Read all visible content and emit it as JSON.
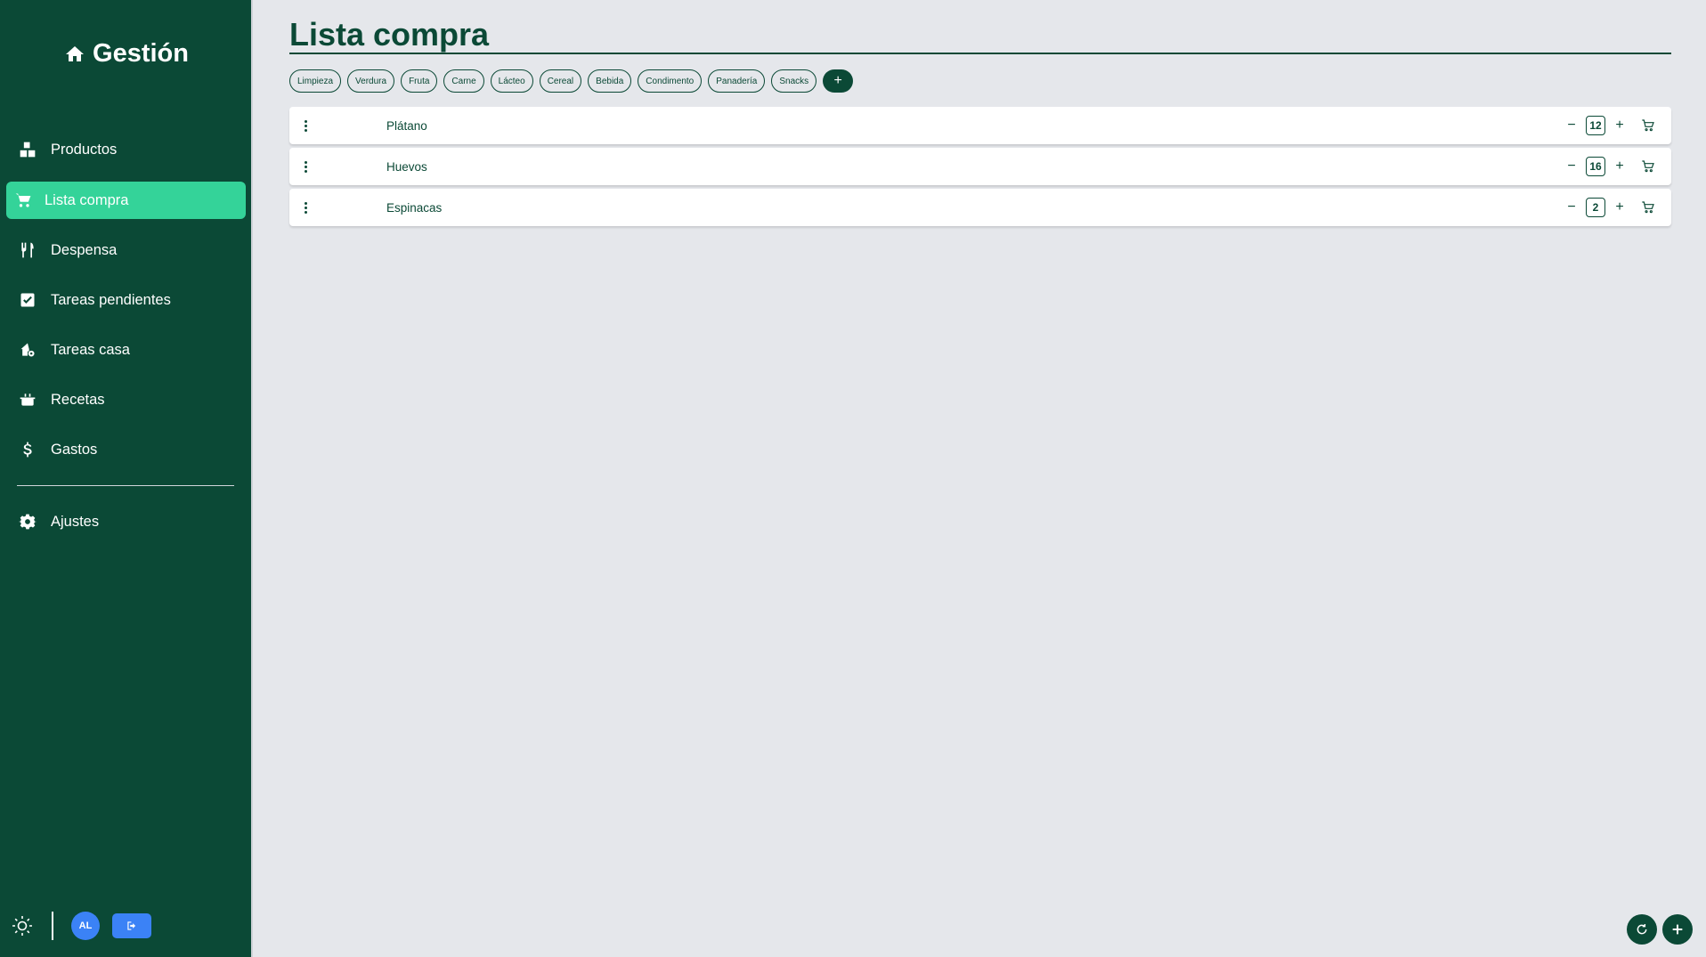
{
  "app": {
    "brand": "Gestión"
  },
  "sidebar": {
    "items": [
      {
        "label": "Productos",
        "icon": "boxes-icon"
      },
      {
        "label": "Lista compra",
        "icon": "cart-icon",
        "active": true
      },
      {
        "label": "Despensa",
        "icon": "utensils-icon"
      },
      {
        "label": "Tareas pendientes",
        "icon": "checkbox-icon"
      },
      {
        "label": "Tareas casa",
        "icon": "house-gear-icon"
      },
      {
        "label": "Recetas",
        "icon": "pot-icon"
      },
      {
        "label": "Gastos",
        "icon": "dollar-icon"
      },
      {
        "label": "Ajustes",
        "icon": "gear-icon"
      }
    ],
    "user_initials": "AL"
  },
  "main": {
    "title": "Lista compra",
    "categories": [
      "Limpieza",
      "Verdura",
      "Fruta",
      "Carne",
      "Lácteo",
      "Cereal",
      "Bebida",
      "Condimento",
      "Panadería",
      "Snacks"
    ],
    "add_category_label": "+",
    "items": [
      {
        "name": "Plátano",
        "qty": "12"
      },
      {
        "name": "Huevos",
        "qty": "16"
      },
      {
        "name": "Espinacas",
        "qty": "2"
      }
    ]
  },
  "colors": {
    "primary": "#0b4936",
    "accent": "#34d399",
    "blue": "#3b82f6",
    "background": "#e5e7eb"
  }
}
